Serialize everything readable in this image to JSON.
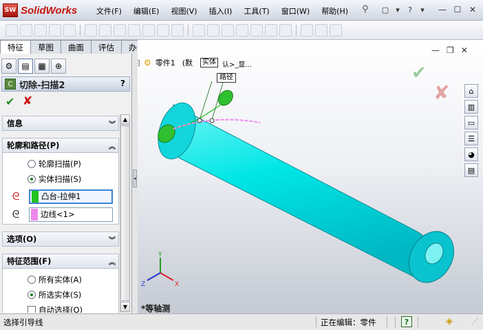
{
  "app": {
    "logo_badge": "SW",
    "logo_text": "SolidWorks"
  },
  "menu": [
    "文件(F)",
    "编辑(E)",
    "视图(V)",
    "插入(I)",
    "工具(T)",
    "窗口(W)",
    "帮助(H)"
  ],
  "tabs": [
    {
      "label": "特征",
      "active": true
    },
    {
      "label": "草图",
      "active": false
    },
    {
      "label": "曲面",
      "active": false
    },
    {
      "label": "评估",
      "active": false
    },
    {
      "label": "办公室产品",
      "active": false
    }
  ],
  "property_manager": {
    "title": "切除-扫描2",
    "help": "?",
    "groups": {
      "info": {
        "label": "信息"
      },
      "profile_path": {
        "label": "轮廓和路径(P)",
        "option_profile_sweep": "轮廓扫描(P)",
        "option_solid_sweep": "实体扫描(S)",
        "selected_option": "实体扫描(S)",
        "solid_selection": "凸台-拉伸1",
        "path_selection": "边线<1>"
      },
      "options": {
        "label": "选项(O)"
      },
      "feature_scope": {
        "label": "特征范围(F)",
        "option_all": "所有实体(A)",
        "option_selected": "所选实体(S)",
        "selected_option": "所选实体(S)",
        "auto_select": "自动选择(O)",
        "auto_select_checked": false
      }
    }
  },
  "graphics": {
    "tree_root": "零件1",
    "tree_suffix": "(默",
    "callout_solid": "实体",
    "callout_suffix": "认>_显...",
    "callout_path": "路径",
    "view_name": "*等轴测",
    "triad_labels": {
      "x": "X",
      "y": "Y",
      "z": "Z"
    },
    "colors": {
      "body": "#00e5e5",
      "body_dark": "#00a6b0",
      "boss": "#2fbf2f",
      "path": "#ee88ee"
    }
  },
  "status": {
    "left": "选择引导线",
    "editing": "正在编辑：零件",
    "help_icon": "?"
  }
}
